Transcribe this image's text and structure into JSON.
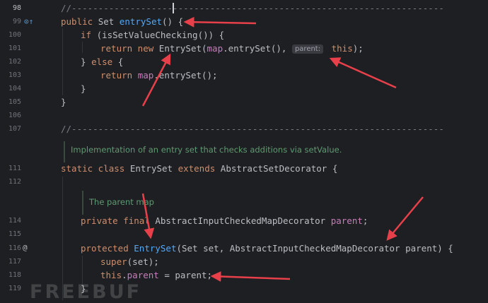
{
  "gutter": {
    "line_numbers": [
      "98",
      "99",
      "100",
      "101",
      "102",
      "103",
      "104",
      "105",
      "106",
      "107",
      "111",
      "112",
      "114",
      "115",
      "116",
      "117",
      "118",
      "119"
    ],
    "icons": {
      "override_glyph": "⊙↑",
      "implements_glyph": "@"
    }
  },
  "code": {
    "l98": "//----------------------------------------------------------------------",
    "l99": [
      "public ",
      "Set ",
      "entrySet",
      "() {"
    ],
    "l100": [
      "if ",
      "(isSetValueChecking()) {"
    ],
    "l101": [
      "return new ",
      "EntrySet(",
      "map",
      ".entrySet(), ",
      "parent:",
      " this",
      ");"
    ],
    "l102": [
      "} ",
      "else ",
      "{"
    ],
    "l103": [
      "return ",
      "map",
      ".entrySet();"
    ],
    "l104": "}",
    "l105": "}",
    "l107": "//----------------------------------------------------------------------",
    "doc1": "Implementation of an entry set that checks additions via setValue.",
    "l111": [
      "static class ",
      "EntrySet ",
      "extends ",
      "AbstractSetDecorator {"
    ],
    "doc2": "The parent map",
    "l114": [
      "private final ",
      "AbstractInputCheckedMapDecorator ",
      "parent",
      ";"
    ],
    "l116": [
      "protected ",
      "EntrySet",
      "(Set set, AbstractInputCheckedMapDecorator parent) {"
    ],
    "l117": [
      "super",
      "(set);"
    ],
    "l118": [
      "this",
      ".",
      "parent",
      " = parent;"
    ],
    "l119": "}"
  },
  "watermark": "FREEBUF",
  "colors": {
    "background": "#1e1f22",
    "keyword": "#cf8e6d",
    "function": "#56a8f5",
    "field": "#c77dbb",
    "comment": "#7a7e85",
    "doc": "#5f9a72",
    "arrow": "#e8404a"
  }
}
